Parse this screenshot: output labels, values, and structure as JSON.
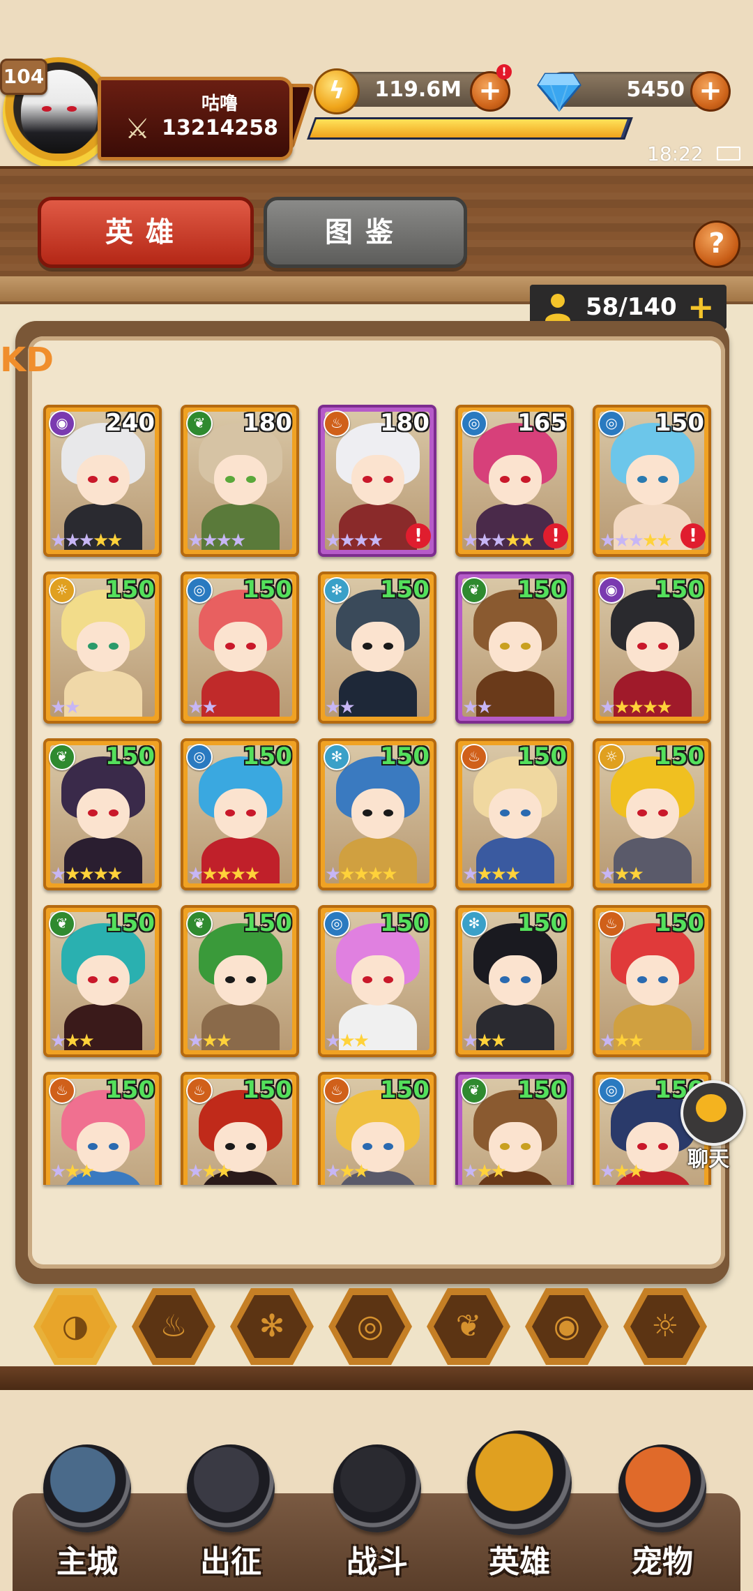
{
  "player": {
    "level": "104",
    "name": "咕噜",
    "power": "13214258"
  },
  "resources": {
    "gold": "119.6M",
    "gold_alert": "!",
    "gems": "5450",
    "plus_label": "+",
    "xp_progress": 0.99
  },
  "status": {
    "time": "18:22"
  },
  "tabs": {
    "heroes": "英雄",
    "codex": "图鉴",
    "help": "?"
  },
  "roster": {
    "capacity": "58/140",
    "plus_label": "+"
  },
  "hero_cards": [
    {
      "level": "240",
      "element": "dark",
      "frame": "gold",
      "lvl_color": "white",
      "purple_stars": 3,
      "gold_stars": 2,
      "alert": false,
      "hair": "#e8e8ea",
      "eyes": "#c9182a",
      "outfit": "#2a2a30"
    },
    {
      "level": "180",
      "element": "nature",
      "frame": "gold",
      "lvl_color": "white",
      "purple_stars": 4,
      "gold_stars": 0,
      "alert": false,
      "hair": "#d6c3a4",
      "eyes": "#5aa83a",
      "outfit": "#5a7a3a"
    },
    {
      "level": "180",
      "element": "fire",
      "frame": "purple",
      "lvl_color": "white",
      "purple_stars": 4,
      "gold_stars": 0,
      "alert": true,
      "hair": "#eeeef2",
      "eyes": "#c9182a",
      "outfit": "#8a2a2a"
    },
    {
      "level": "165",
      "element": "water",
      "frame": "gold",
      "lvl_color": "white",
      "purple_stars": 3,
      "gold_stars": 2,
      "alert": true,
      "hair": "#d7407a",
      "eyes": "#c9182a",
      "outfit": "#4a2a4a"
    },
    {
      "level": "150",
      "element": "water",
      "frame": "gold",
      "lvl_color": "white",
      "purple_stars": 3,
      "gold_stars": 2,
      "alert": true,
      "hair": "#6cc6ea",
      "eyes": "#2a7ab0",
      "outfit": "#f3d9c2"
    },
    {
      "level": "150",
      "element": "light",
      "frame": "gold",
      "lvl_color": "green",
      "purple_stars": 2,
      "gold_stars": 0,
      "alert": false,
      "hair": "#f2dc8a",
      "eyes": "#2a9a6a",
      "outfit": "#f0d8a8"
    },
    {
      "level": "150",
      "element": "water",
      "frame": "gold",
      "lvl_color": "green",
      "purple_stars": 2,
      "gold_stars": 0,
      "alert": false,
      "hair": "#e86060",
      "eyes": "#c9182a",
      "outfit": "#c02a2a"
    },
    {
      "level": "150",
      "element": "ice",
      "frame": "gold",
      "lvl_color": "green",
      "purple_stars": 2,
      "gold_stars": 0,
      "alert": false,
      "hair": "#3a4a5a",
      "eyes": "#1a1a1a",
      "outfit": "#1e2838"
    },
    {
      "level": "150",
      "element": "nature",
      "frame": "purple",
      "lvl_color": "green",
      "purple_stars": 2,
      "gold_stars": 0,
      "alert": false,
      "hair": "#8a5a30",
      "eyes": "#c9a020",
      "outfit": "#6a3a1a"
    },
    {
      "level": "150",
      "element": "dark",
      "frame": "gold",
      "lvl_color": "green",
      "purple_stars": 1,
      "gold_stars": 4,
      "alert": false,
      "hair": "#2a2a2e",
      "eyes": "#c9182a",
      "outfit": "#a01a2a"
    },
    {
      "level": "150",
      "element": "nature",
      "frame": "gold",
      "lvl_color": "green",
      "purple_stars": 1,
      "gold_stars": 4,
      "alert": false,
      "hair": "#3a2a4a",
      "eyes": "#c9182a",
      "outfit": "#2a1e30"
    },
    {
      "level": "150",
      "element": "water",
      "frame": "gold",
      "lvl_color": "green",
      "purple_stars": 1,
      "gold_stars": 4,
      "alert": false,
      "hair": "#3aa8e0",
      "eyes": "#c9182a",
      "outfit": "#c0202a"
    },
    {
      "level": "150",
      "element": "ice",
      "frame": "gold",
      "lvl_color": "green",
      "purple_stars": 1,
      "gold_stars": 4,
      "alert": false,
      "hair": "#3a7ac0",
      "eyes": "#1a1a1a",
      "outfit": "#d0a040"
    },
    {
      "level": "150",
      "element": "fire",
      "frame": "gold",
      "lvl_color": "green",
      "purple_stars": 1,
      "gold_stars": 3,
      "alert": false,
      "hair": "#f0d8a0",
      "eyes": "#2a6ab0",
      "outfit": "#3a5aa0"
    },
    {
      "level": "150",
      "element": "light",
      "frame": "gold",
      "lvl_color": "green",
      "purple_stars": 1,
      "gold_stars": 2,
      "alert": false,
      "hair": "#f0c020",
      "eyes": "#c9182a",
      "outfit": "#5a5a6a"
    },
    {
      "level": "150",
      "element": "nature",
      "frame": "gold",
      "lvl_color": "green",
      "purple_stars": 1,
      "gold_stars": 2,
      "alert": false,
      "hair": "#2ab0b0",
      "eyes": "#c9182a",
      "outfit": "#3a1a1a"
    },
    {
      "level": "150",
      "element": "nature",
      "frame": "gold",
      "lvl_color": "green",
      "purple_stars": 1,
      "gold_stars": 2,
      "alert": false,
      "hair": "#3a9a3a",
      "eyes": "#1a1a1a",
      "outfit": "#8a6a4a"
    },
    {
      "level": "150",
      "element": "water",
      "frame": "gold",
      "lvl_color": "green",
      "purple_stars": 1,
      "gold_stars": 2,
      "alert": false,
      "hair": "#e080e0",
      "eyes": "#c9182a",
      "outfit": "#f0f0f0"
    },
    {
      "level": "150",
      "element": "ice",
      "frame": "gold",
      "lvl_color": "green",
      "purple_stars": 1,
      "gold_stars": 2,
      "alert": false,
      "hair": "#1a1a20",
      "eyes": "#2a6ab0",
      "outfit": "#2a2a30"
    },
    {
      "level": "150",
      "element": "fire",
      "frame": "gold",
      "lvl_color": "green",
      "purple_stars": 1,
      "gold_stars": 2,
      "alert": false,
      "hair": "#e03a3a",
      "eyes": "#2a6ab0",
      "outfit": "#d0a040"
    },
    {
      "level": "150",
      "element": "fire",
      "frame": "gold",
      "lvl_color": "green",
      "purple_stars": 1,
      "gold_stars": 2,
      "alert": false,
      "hair": "#f07090",
      "eyes": "#2a6ab0",
      "outfit": "#3a7ac0"
    },
    {
      "level": "150",
      "element": "fire",
      "frame": "gold",
      "lvl_color": "green",
      "purple_stars": 1,
      "gold_stars": 2,
      "alert": false,
      "hair": "#c02a1a",
      "eyes": "#1a1a1a",
      "outfit": "#2a1a1a"
    },
    {
      "level": "150",
      "element": "fire",
      "frame": "gold",
      "lvl_color": "green",
      "purple_stars": 1,
      "gold_stars": 2,
      "alert": false,
      "hair": "#f0c040",
      "eyes": "#2a6ab0",
      "outfit": "#5a5a6a"
    },
    {
      "level": "150",
      "element": "nature",
      "frame": "purple",
      "lvl_color": "green",
      "purple_stars": 1,
      "gold_stars": 2,
      "alert": false,
      "hair": "#8a5a30",
      "eyes": "#c9a020",
      "outfit": "#6a3a1a"
    },
    {
      "level": "150",
      "element": "water",
      "frame": "gold",
      "lvl_color": "green",
      "purple_stars": 1,
      "gold_stars": 2,
      "alert": false,
      "hair": "#2a3a6a",
      "eyes": "#c9182a",
      "outfit": "#c0202a"
    }
  ],
  "element_icons": {
    "dark": "eye-icon",
    "nature": "leaf-icon",
    "fire": "flame-icon",
    "water": "swirl-icon",
    "ice": "snowflake-icon",
    "light": "sun-icon"
  },
  "element_colors": {
    "dark": "#7a3ab0",
    "nature": "#2f8a2f",
    "fire": "#d0601a",
    "water": "#2a7ac0",
    "ice": "#3aa0c8",
    "light": "#e0a020"
  },
  "filters": [
    "all",
    "fire",
    "ice",
    "water",
    "nature",
    "dark",
    "light"
  ],
  "filter_icons": [
    "all-filter-icon",
    "fire-filter-icon",
    "ice-filter-icon",
    "water-filter-icon",
    "nature-filter-icon",
    "dark-filter-icon",
    "light-filter-icon"
  ],
  "chat": {
    "label": "聊天"
  },
  "nav": [
    {
      "label": "主城",
      "icon": "castle-tower-icon",
      "color": "#4a6a8a"
    },
    {
      "label": "出征",
      "icon": "crystal-gate-icon",
      "color": "#3a3a44"
    },
    {
      "label": "战斗",
      "icon": "crossed-swords-shield-icon",
      "color": "#2a2a30"
    },
    {
      "label": "英雄",
      "icon": "golden-helmet-icon",
      "color": "#e0a020"
    },
    {
      "label": "宠物",
      "icon": "dragon-pet-icon",
      "color": "#e06a2a"
    }
  ],
  "colors": {
    "accent_red": "#b42716",
    "gold_frame": "#f0a223",
    "purple_frame": "#b65bc9",
    "level_green": "#54e05c"
  }
}
